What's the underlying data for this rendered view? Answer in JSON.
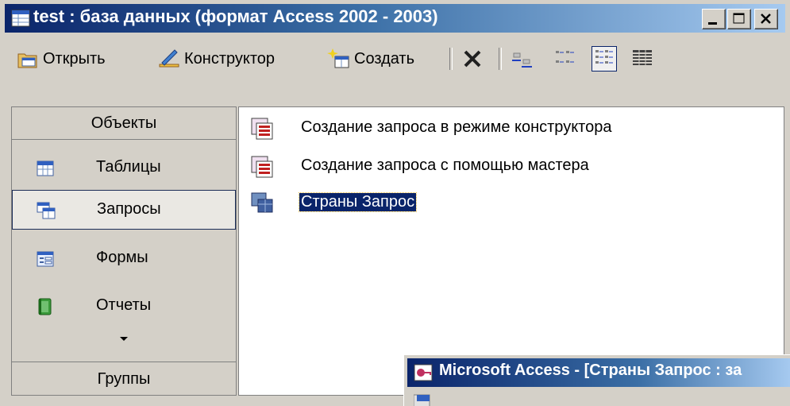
{
  "window": {
    "title": "test : база данных (формат Access 2002 - 2003)"
  },
  "toolbar": {
    "open_label": "Открыть",
    "design_label": "Конструктор",
    "create_label": "Создать"
  },
  "objects": {
    "header": "Объекты",
    "items": [
      {
        "label": "Таблицы",
        "icon": "table-icon"
      },
      {
        "label": "Запросы",
        "icon": "query-icon",
        "selected": true
      },
      {
        "label": "Формы",
        "icon": "form-icon"
      },
      {
        "label": "Отчеты",
        "icon": "report-icon"
      }
    ],
    "groups_header": "Группы"
  },
  "list": {
    "items": [
      {
        "label": "Создание запроса в режиме конструктора",
        "icon": "wizard-icon"
      },
      {
        "label": "Создание запроса с помощью мастера",
        "icon": "wizard-icon"
      },
      {
        "label": "Страны Запрос",
        "icon": "query-icon",
        "selected": true
      }
    ]
  },
  "second_window": {
    "title": "Microsoft Access - [Страны Запрос : за"
  },
  "colors": {
    "titlebar_start": "#0a246a",
    "titlebar_end": "#a6caf0",
    "face": "#d4d0c8",
    "selection": "#0a246a"
  }
}
